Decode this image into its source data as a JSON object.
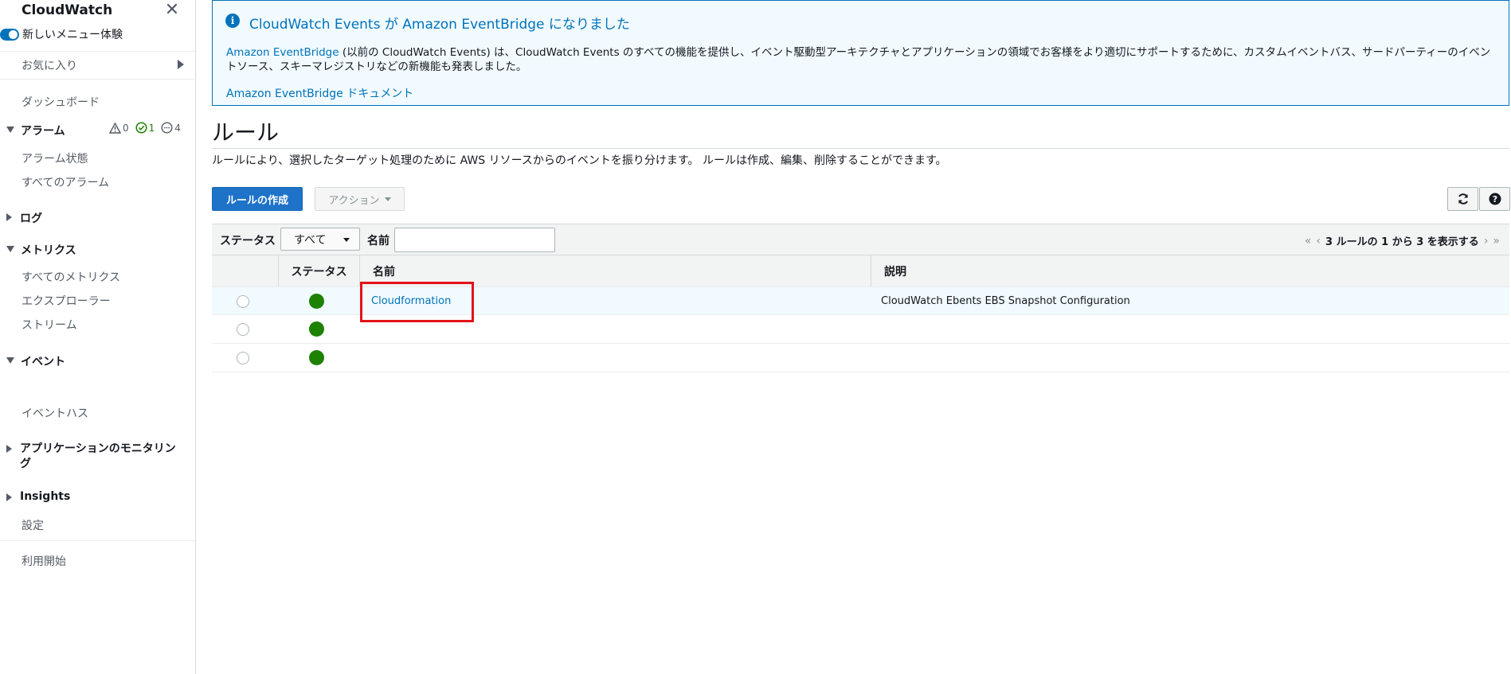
{
  "sidebar": {
    "title": "CloudWatch",
    "close_glyph": "✕",
    "new_menu_label": "新しいメニュー体験",
    "favorites_label": "お気に入り",
    "dashboard_label": "ダッシュボード",
    "alarms_label": "アラーム",
    "alarm_counts": {
      "alarm": "0",
      "ok": "1",
      "insufficient": "4"
    },
    "alarm_state_label": "アラーム状態",
    "all_alarms_label": "すべてのアラーム",
    "logs_label": "ログ",
    "metrics_label": "メトリクス",
    "all_metrics_label": "すべてのメトリクス",
    "explorer_label": "エクスプローラー",
    "streams_label": "ストリーム",
    "events_label": "イベント",
    "event_bus_label": "イベントハス",
    "app_monitoring_label": "アプリケーションのモニタリング",
    "insights_label": "Insights",
    "settings_label": "設定",
    "getting_started_label": "利用開始"
  },
  "banner": {
    "title": "CloudWatch Events が Amazon EventBridge になりました",
    "body_link": "Amazon EventBridge",
    "body_text": " (以前の CloudWatch Events) は、CloudWatch Events のすべての機能を提供し、イベント駆動型アーキテクチャとアプリケーションの領域でお客様をより適切にサポートするために、カスタムイベントバス、サードパーティーのイベントソース、スキーマレジストリなどの新機能も発表しました。",
    "doc_link": "Amazon EventBridge ドキュメント"
  },
  "page": {
    "title": "ルール",
    "description": "ルールにより、選択したターゲット処理のために AWS リソースからのイベントを振り分けます。 ルールは作成、編集、削除することができます。"
  },
  "toolbar": {
    "create_rule_label": "ルールの作成",
    "actions_label": "アクション"
  },
  "filter": {
    "status_label": "ステータス",
    "status_value": "すべて",
    "name_label": "名前",
    "name_value": "",
    "pagination_text": "3 ルールの 1 から 3 を表示する"
  },
  "table": {
    "columns": {
      "status": "ステータス",
      "name": "名前",
      "description": "説明"
    },
    "rows": [
      {
        "name": "Cloudformation",
        "description": "CloudWatch Ebents EBS Snapshot Configuration",
        "status": "enabled"
      },
      {
        "name": "",
        "description": "",
        "status": "enabled"
      },
      {
        "name": "",
        "description": "",
        "status": "enabled"
      }
    ]
  },
  "colors": {
    "accent": "#0073bb",
    "primary_button": "#1e73c8",
    "status_ok": "#1d8102",
    "highlight": "#e2131b"
  }
}
